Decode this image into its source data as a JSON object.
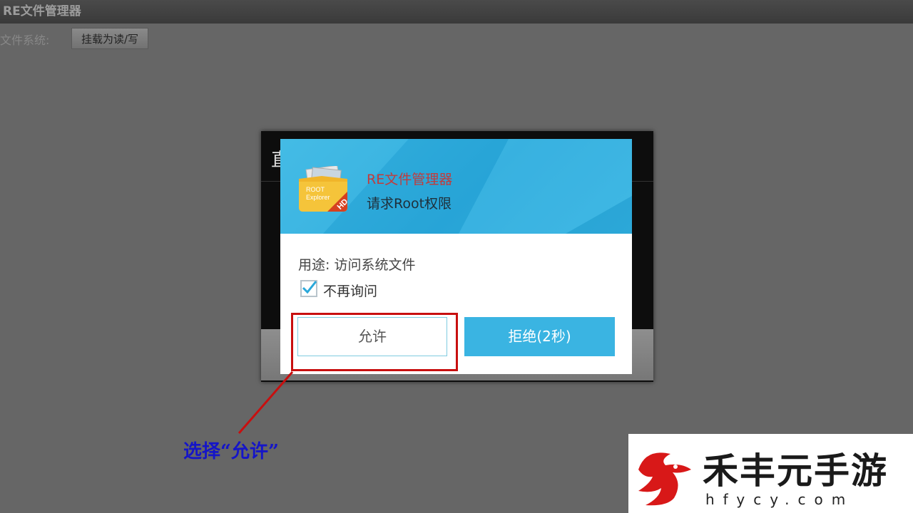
{
  "app": {
    "title": "RE文件管理器"
  },
  "toolbar": {
    "fs_label": "文件系统:",
    "mount_button": "挂载为读/写"
  },
  "back_dialog": {
    "title_fragment": "直"
  },
  "su_request": {
    "app_name": "RE文件管理器",
    "request_text": "请求Root权限",
    "purpose": "用途: 访问系统文件",
    "remember_label": "不再询问",
    "remember_checked": true,
    "allow_button": "允许",
    "deny_button": "拒绝(2秒)",
    "header_color": "#2aa8da",
    "app_icon": "root-explorer-hd-icon"
  },
  "annotation": {
    "text": "选择“允许”",
    "color": "#1515c8",
    "highlight_color": "#c80f0f"
  },
  "watermark": {
    "title": "禾丰元手游",
    "url": "hfycy.com",
    "logo": "dragon-logo"
  }
}
